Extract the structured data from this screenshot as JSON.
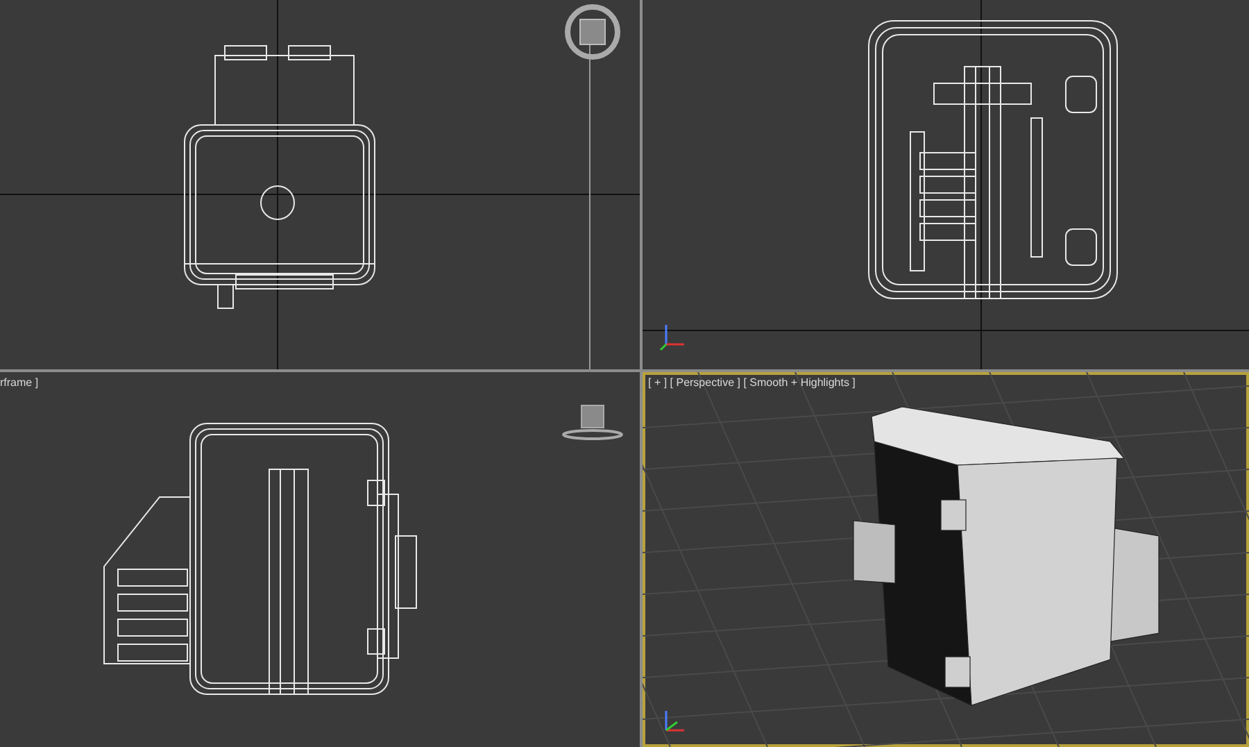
{
  "viewports": [
    {
      "kind": "front",
      "active": false
    },
    {
      "kind": "top",
      "active": false
    },
    {
      "kind": "side",
      "active": false,
      "label": "rframe ]"
    },
    {
      "kind": "perspective",
      "active": true,
      "label": "[ + ] [ Perspective ] [ Smooth + Highlights ]"
    }
  ]
}
